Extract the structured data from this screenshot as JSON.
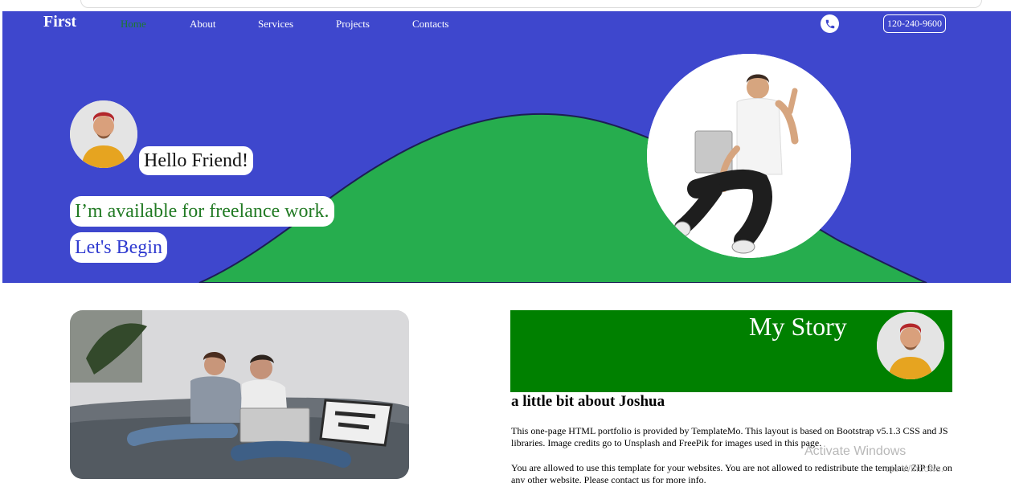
{
  "navbar": {
    "brand": "First",
    "links": [
      "Home",
      "About",
      "Services",
      "Projects",
      "Contacts"
    ],
    "active_link": "Home",
    "phone": "120-240-9600",
    "phone_icon": "phone-icon"
  },
  "hero": {
    "greeting": "Hello Friend!",
    "tagline": "I’m available for freelance work.",
    "cta": "Let's Begin"
  },
  "story": {
    "title": "My Story",
    "heading": "a little bit about Joshua",
    "paragraph1": "This one-page HTML portfolio is provided by TemplateMo. This layout is based on Bootstrap v5.1.3 CSS and JS libraries. Image credits go to Unsplash and FreePik for images used in this page.",
    "paragraph2": "You are allowed to use this template for your websites. You are not allowed to redistribute the template ZIP file on any other website. Please contact us for more info."
  },
  "watermark": {
    "line1": "Activate Windows",
    "line2": "ate Windows."
  },
  "colors": {
    "hero_bg": "#3e47cd",
    "hill": "#26ad4e",
    "story_banner": "#008000",
    "active_link": "#1b7a2e"
  }
}
